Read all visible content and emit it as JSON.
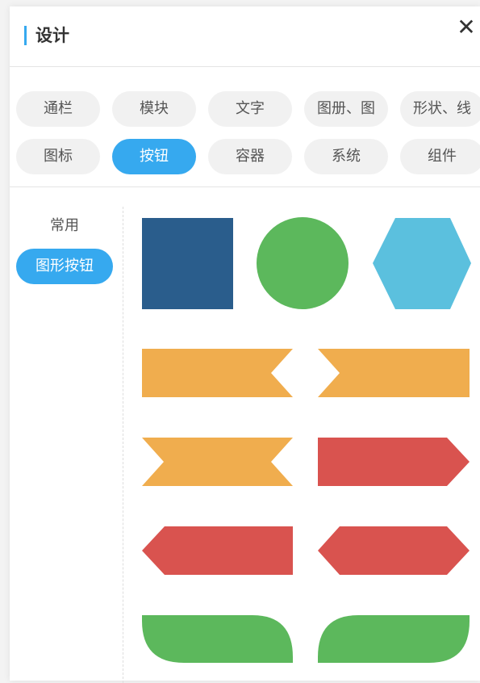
{
  "panel": {
    "title": "设计",
    "close_icon": "✕"
  },
  "tabs": [
    {
      "label": "通栏",
      "active": false
    },
    {
      "label": "模块",
      "active": false
    },
    {
      "label": "文字",
      "active": false
    },
    {
      "label": "图册、图",
      "active": false
    },
    {
      "label": "形状、线",
      "active": false
    },
    {
      "label": "图标",
      "active": false
    },
    {
      "label": "按钮",
      "active": true
    },
    {
      "label": "容器",
      "active": false
    },
    {
      "label": "系统",
      "active": false
    },
    {
      "label": "组件",
      "active": false
    }
  ],
  "nav": [
    {
      "label": "常用",
      "active": false
    },
    {
      "label": "图形按钮",
      "active": true
    }
  ],
  "colors": {
    "accent": "#36a9ef",
    "navy": "#2a5d8c",
    "green": "#5cb85c",
    "sky": "#5bc0de",
    "orange": "#f0ad4e",
    "red": "#d9534f"
  },
  "shapes": [
    {
      "name": "square-button-shape",
      "type": "square",
      "color": "navy"
    },
    {
      "name": "circle-button-shape",
      "type": "circle",
      "color": "green"
    },
    {
      "name": "hexagon-button-shape",
      "type": "hexagon",
      "color": "sky"
    },
    {
      "name": "ribbon-notch-right-shape",
      "type": "ribbon-notch-right",
      "color": "orange"
    },
    {
      "name": "ribbon-notch-left-shape",
      "type": "ribbon-notch-left",
      "color": "orange"
    },
    {
      "name": "ribbon-notch-both-shape",
      "type": "ribbon-notch-both",
      "color": "orange"
    },
    {
      "name": "arrow-right-shape",
      "type": "arrow-right",
      "color": "red"
    },
    {
      "name": "arrow-left-shape",
      "type": "arrow-left",
      "color": "red"
    },
    {
      "name": "double-arrow-shape",
      "type": "double-arrow",
      "color": "red"
    },
    {
      "name": "leaf-left-shape",
      "type": "leaf-left",
      "color": "green"
    },
    {
      "name": "leaf-right-shape",
      "type": "leaf-right",
      "color": "green"
    }
  ]
}
